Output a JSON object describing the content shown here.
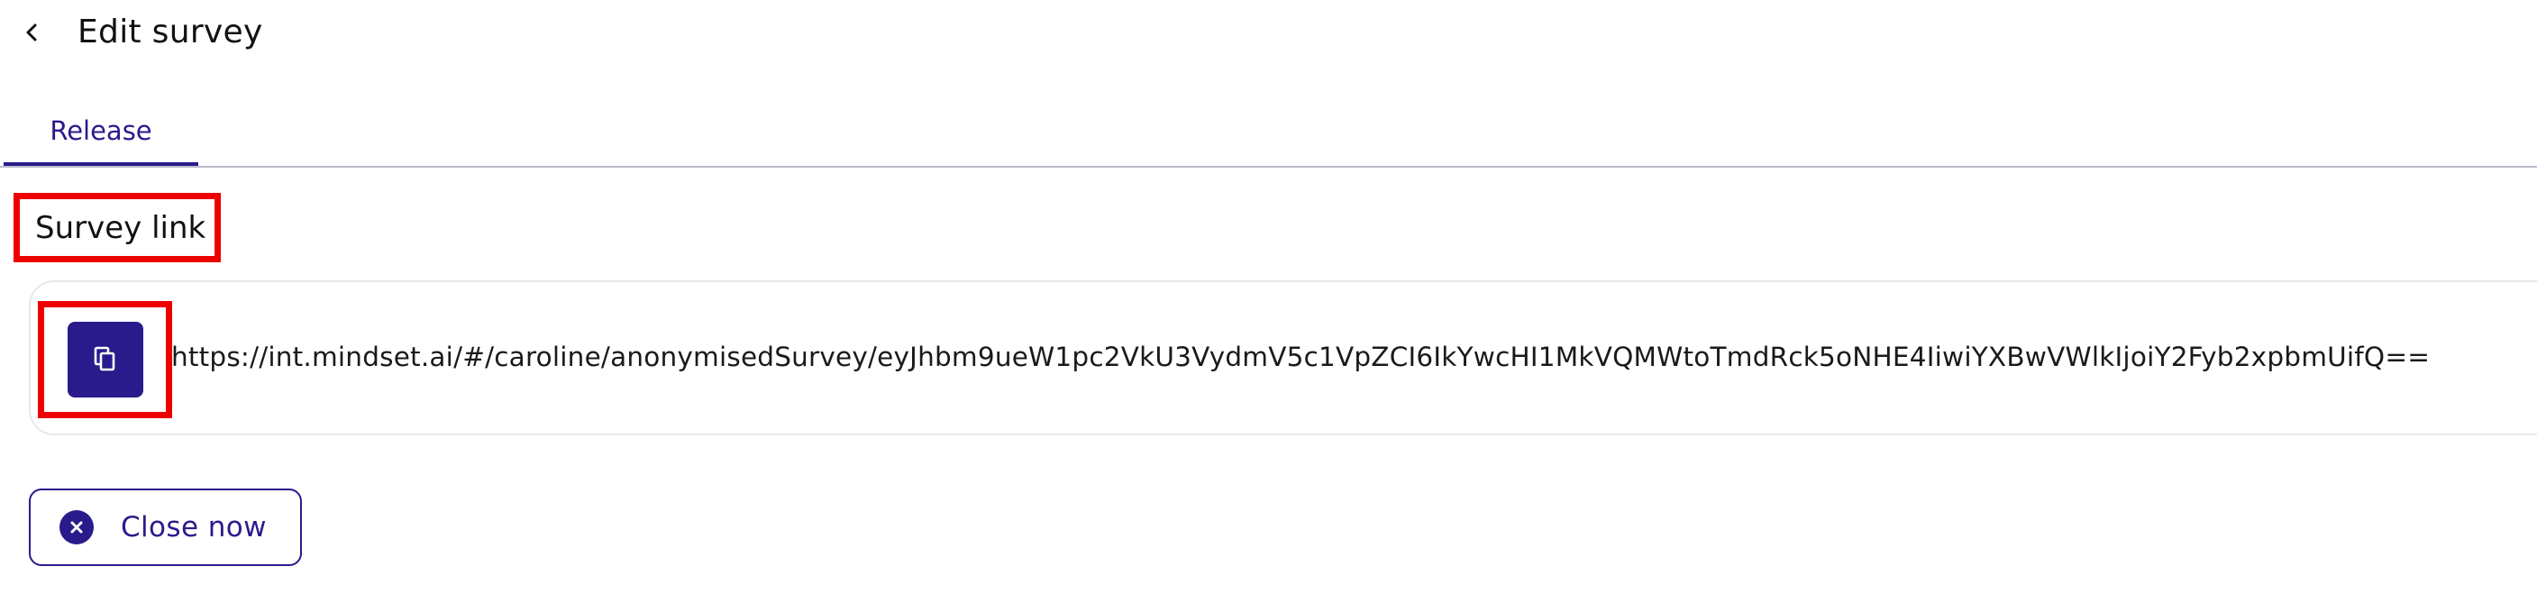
{
  "header": {
    "back_icon": "chevron-left-icon",
    "title": "Edit survey"
  },
  "tabs": [
    {
      "label": "Release",
      "active": true
    }
  ],
  "survey_link": {
    "label": "Survey link",
    "copy_icon": "copy-icon",
    "url": "https://int.mindset.ai/#/caroline/anonymisedSurvey/eyJhbm9ueW1pc2VkU3VydmV5c1VpZCI6IkYwcHI1MkVQMWtoTmdRck5oNHE4IiwiYXBwVWlkIjoiY2Fyb2xpbmUifQ=="
  },
  "actions": {
    "close_label": "Close now",
    "close_icon": "close-circle-icon"
  },
  "colors": {
    "accent": "#2a1b8c",
    "highlight": "#ee0000",
    "divider": "#b9b9c9",
    "card_border": "#e7e7ec"
  }
}
